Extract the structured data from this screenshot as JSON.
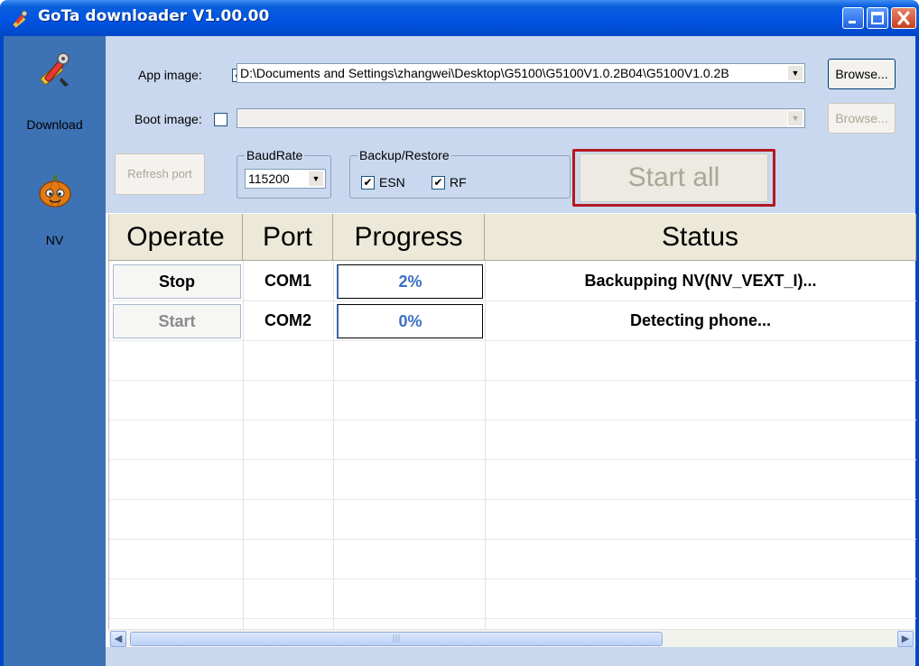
{
  "window": {
    "title": "GoTa downloader V1.00.00"
  },
  "sidebar": {
    "items": [
      {
        "label": "Download",
        "icon": "tools-icon"
      },
      {
        "label": "NV",
        "icon": "pumpkin-icon"
      }
    ]
  },
  "controls": {
    "app_image_label": "App image:",
    "app_image_checked": true,
    "app_image_path": "D:\\Documents and Settings\\zhangwei\\Desktop\\G5100\\G5100V1.0.2B04\\G5100V1.0.2B",
    "boot_image_label": "Boot image:",
    "boot_image_checked": false,
    "boot_image_path": "",
    "browse_label": "Browse...",
    "refresh_port_label": "Refresh port",
    "baudrate_title": "BaudRate",
    "baudrate_value": "115200",
    "backup_title": "Backup/Restore",
    "esn_label": "ESN",
    "esn_checked": true,
    "rf_label": "RF",
    "rf_checked": true,
    "start_all_label": "Start all"
  },
  "table": {
    "columns": [
      "Operate",
      "Port",
      "Progress",
      "Status"
    ],
    "rows": [
      {
        "operate": "Stop",
        "operate_enabled": true,
        "port": "COM1",
        "progress": "2%",
        "status": "Backupping NV(NV_VEXT_I)..."
      },
      {
        "operate": "Start",
        "operate_enabled": false,
        "port": "COM2",
        "progress": "0%",
        "status": "Detecting phone..."
      }
    ]
  },
  "colors": {
    "titlebar": "#0054e3",
    "sidebar": "#3d72b4",
    "panel": "#c9d8ee",
    "start_all_border": "#b51820",
    "progress_text": "#3a6fc4"
  }
}
